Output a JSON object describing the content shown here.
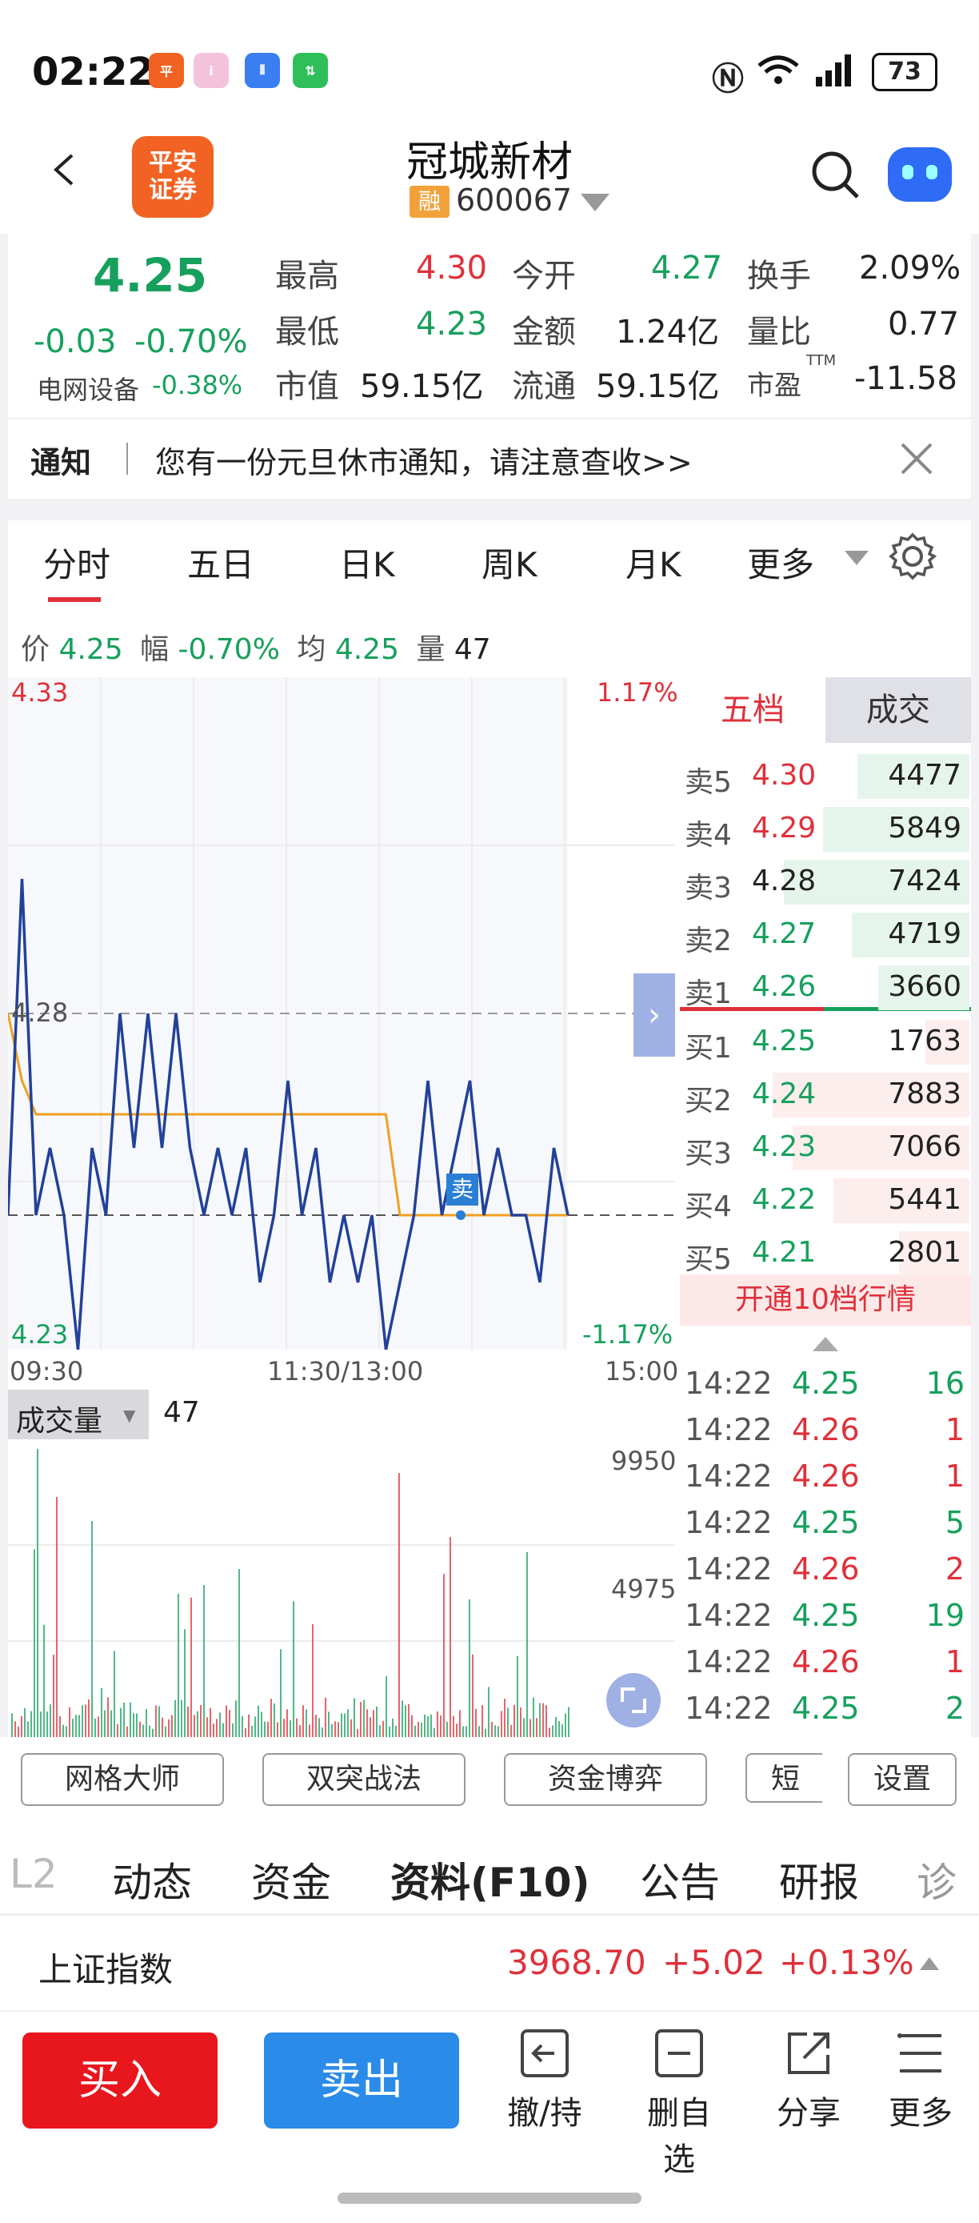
{
  "status_bar": {
    "time": "02:22",
    "battery": "73"
  },
  "header": {
    "title": "冠城新材",
    "margin_tag": "融",
    "code": "600067",
    "logo_line1": "平安",
    "logo_line2": "证券"
  },
  "quote": {
    "price": "4.25",
    "change": "-0.03",
    "change_pct": "-0.70%",
    "sector": "电网设备",
    "sector_pct": "-0.38%",
    "items": [
      {
        "label": "最高",
        "value": "4.30"
      },
      {
        "label": "今开",
        "value": "4.27"
      },
      {
        "label": "换手",
        "value": "2.09%"
      },
      {
        "label": "最低",
        "value": "4.23"
      },
      {
        "label": "金额",
        "value": "1.24亿"
      },
      {
        "label": "量比",
        "value": "0.77"
      },
      {
        "label": "市值",
        "value": "59.15亿"
      },
      {
        "label": "流通",
        "value": "59.15亿"
      },
      {
        "label": "市盈",
        "value": "-11.58",
        "sup": "TTM"
      }
    ]
  },
  "notice": {
    "label": "通知",
    "text": "您有一份元旦休市通知，请注意查收>>"
  },
  "tabs": [
    "分时",
    "五日",
    "日K",
    "周K",
    "月K",
    "更多"
  ],
  "info_line": {
    "price_label": "价",
    "price": "4.25",
    "amp_label": "幅",
    "amp": "-0.70%",
    "avg_label": "均",
    "avg": "4.25",
    "vol_label": "量",
    "vol": "47"
  },
  "chart": {
    "y_top": "4.33",
    "y_mid": "4.28",
    "y_bot": "4.23",
    "pct_top": "1.17%",
    "pct_bot": "-1.17%",
    "x_start": "09:30",
    "x_mid": "11:30/13:00",
    "x_end": "15:00",
    "sell_mark": "卖",
    "volume_label": "成交量",
    "volume_value": "47",
    "vol_top": "9950",
    "vol_mid": "4975"
  },
  "chart_data": {
    "type": "line",
    "series": [
      {
        "values": [
          4.25,
          4.3,
          4.25,
          4.26,
          4.25,
          4.23,
          4.26,
          4.25,
          4.28,
          4.26,
          4.28,
          4.26,
          4.28,
          4.26,
          4.25,
          4.26,
          4.25,
          4.26,
          4.24,
          4.25,
          4.27,
          4.25,
          4.26,
          4.24,
          4.25,
          4.24,
          4.25,
          4.23,
          4.24,
          4.25,
          4.27,
          4.25,
          4.26,
          4.27,
          4.25,
          4.26,
          4.25,
          4.25,
          4.24,
          4.26,
          4.25
        ]
      },
      {
        "values": [
          4.28,
          4.27,
          4.265,
          4.265,
          4.265,
          4.265,
          4.265,
          4.265,
          4.265,
          4.265,
          4.265,
          4.265,
          4.265,
          4.265,
          4.265,
          4.265,
          4.265,
          4.265,
          4.265,
          4.265,
          4.265,
          4.265,
          4.265,
          4.265,
          4.265,
          4.265,
          4.265,
          4.265,
          4.25,
          4.25,
          4.25,
          4.25,
          4.25,
          4.25,
          4.25,
          4.25,
          4.25,
          4.25,
          4.25,
          4.25,
          4.25
        ]
      }
    ],
    "ylim": [
      4.23,
      4.33
    ]
  },
  "order_book": {
    "tab_1": "五档",
    "tab_2": "成交",
    "sells": [
      {
        "label": "卖5",
        "price": "4.30",
        "vol": "4477",
        "dir": "up"
      },
      {
        "label": "卖4",
        "price": "4.29",
        "vol": "5849",
        "dir": "up"
      },
      {
        "label": "卖3",
        "price": "4.28",
        "vol": "7424",
        "dir": "flat"
      },
      {
        "label": "卖2",
        "price": "4.27",
        "vol": "4719",
        "dir": "down"
      },
      {
        "label": "卖1",
        "price": "4.26",
        "vol": "3660",
        "dir": "down"
      }
    ],
    "buys": [
      {
        "label": "买1",
        "price": "4.25",
        "vol": "1763",
        "dir": "down"
      },
      {
        "label": "买2",
        "price": "4.24",
        "vol": "7883",
        "dir": "down"
      },
      {
        "label": "买3",
        "price": "4.23",
        "vol": "7066",
        "dir": "down"
      },
      {
        "label": "买4",
        "price": "4.22",
        "vol": "5441",
        "dir": "down"
      },
      {
        "label": "买5",
        "price": "4.21",
        "vol": "2801",
        "dir": "down"
      }
    ],
    "open_level10": "开通10档行情"
  },
  "trades": [
    {
      "time": "14:22",
      "price": "4.25",
      "vol": "16",
      "side": "sell"
    },
    {
      "time": "14:22",
      "price": "4.26",
      "vol": "1",
      "side": "buy"
    },
    {
      "time": "14:22",
      "price": "4.26",
      "vol": "1",
      "side": "buy"
    },
    {
      "time": "14:22",
      "price": "4.25",
      "vol": "5",
      "side": "sell"
    },
    {
      "time": "14:22",
      "price": "4.26",
      "vol": "2",
      "side": "buy"
    },
    {
      "time": "14:22",
      "price": "4.25",
      "vol": "19",
      "side": "sell"
    },
    {
      "time": "14:22",
      "price": "4.26",
      "vol": "1",
      "side": "buy"
    },
    {
      "time": "14:22",
      "price": "4.25",
      "vol": "2",
      "side": "sell"
    }
  ],
  "tools": {
    "grid": "网格大师",
    "double": "双突战法",
    "fund_game": "资金博弈",
    "short": "短",
    "settings": "设置"
  },
  "bottom_tabs": [
    "L2",
    "动态",
    "资金",
    "资料(F10)",
    "公告",
    "研报",
    "诊"
  ],
  "index_bar": {
    "name": "上证指数",
    "value": "3968.70",
    "change": "+5.02",
    "pct": "+0.13%"
  },
  "actions": {
    "buy": "买入",
    "sell": "卖出",
    "cancel": "撤/持",
    "remove": "删自选",
    "share": "分享",
    "more": "更多"
  },
  "colors": {
    "up": "#e0303a",
    "down": "#17a05d",
    "line": "#22419a",
    "avg": "#f0a020",
    "buy_btn": "#e8161d",
    "sell_btn": "#2a8be8",
    "accent": "#e0303a"
  }
}
